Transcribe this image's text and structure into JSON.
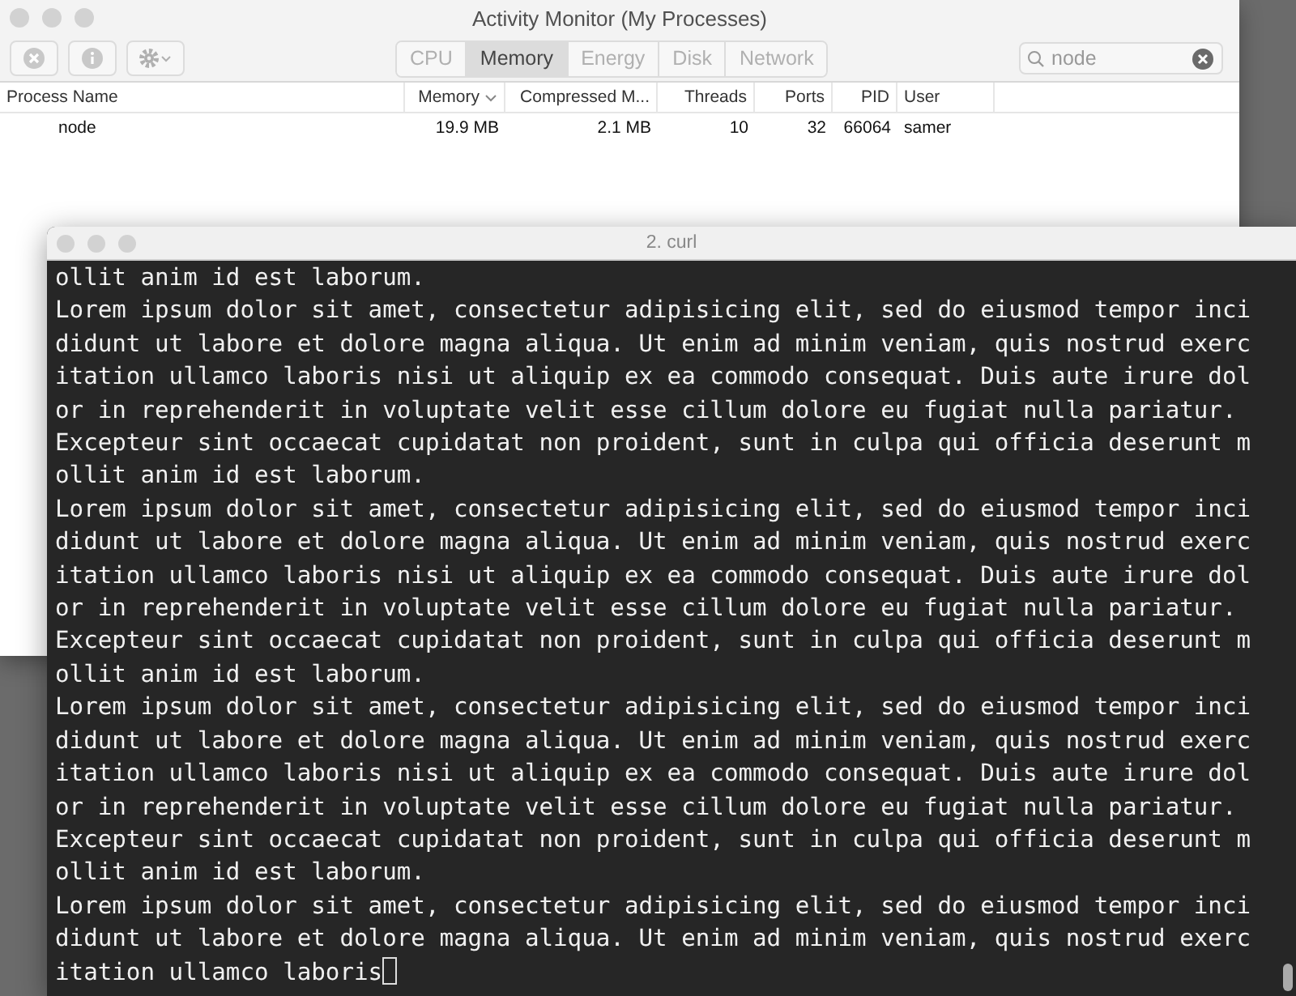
{
  "activity_monitor": {
    "window": {
      "title": "Activity Monitor (My Processes)"
    },
    "tabs": [
      {
        "label": "CPU",
        "selected": false
      },
      {
        "label": "Memory",
        "selected": true
      },
      {
        "label": "Energy",
        "selected": false
      },
      {
        "label": "Disk",
        "selected": false
      },
      {
        "label": "Network",
        "selected": false
      }
    ],
    "search": {
      "value": "node"
    },
    "table": {
      "columns": [
        {
          "label": "Process Name",
          "sorted": false
        },
        {
          "label": "Memory",
          "sorted": true
        },
        {
          "label": "Compressed M...",
          "sorted": false
        },
        {
          "label": "Threads",
          "sorted": false
        },
        {
          "label": "Ports",
          "sorted": false
        },
        {
          "label": "PID",
          "sorted": false
        },
        {
          "label": "User",
          "sorted": false
        }
      ],
      "rows": [
        [
          "node",
          "19.9 MB",
          "2.1 MB",
          "10",
          "32",
          "66064",
          "samer"
        ]
      ]
    }
  },
  "terminal": {
    "window": {
      "title": "2. curl"
    },
    "lines": [
      "ollit anim id est laborum.",
      "Lorem ipsum dolor sit amet, consectetur adipisicing elit, sed do eiusmod tempor inci",
      "didunt ut labore et dolore magna aliqua. Ut enim ad minim veniam, quis nostrud exerc",
      "itation ullamco laboris nisi ut aliquip ex ea commodo consequat. Duis aute irure dol",
      "or in reprehenderit in voluptate velit esse cillum dolore eu fugiat nulla pariatur.",
      "Excepteur sint occaecat cupidatat non proident, sunt in culpa qui officia deserunt m",
      "ollit anim id est laborum.",
      "Lorem ipsum dolor sit amet, consectetur adipisicing elit, sed do eiusmod tempor inci",
      "didunt ut labore et dolore magna aliqua. Ut enim ad minim veniam, quis nostrud exerc",
      "itation ullamco laboris nisi ut aliquip ex ea commodo consequat. Duis aute irure dol",
      "or in reprehenderit in voluptate velit esse cillum dolore eu fugiat nulla pariatur.",
      "Excepteur sint occaecat cupidatat non proident, sunt in culpa qui officia deserunt m",
      "ollit anim id est laborum.",
      "Lorem ipsum dolor sit amet, consectetur adipisicing elit, sed do eiusmod tempor inci",
      "didunt ut labore et dolore magna aliqua. Ut enim ad minim veniam, quis nostrud exerc",
      "itation ullamco laboris nisi ut aliquip ex ea commodo consequat. Duis aute irure dol",
      "or in reprehenderit in voluptate velit esse cillum dolore eu fugiat nulla pariatur.",
      "Excepteur sint occaecat cupidatat non proident, sunt in culpa qui officia deserunt m",
      "ollit anim id est laborum.",
      "Lorem ipsum dolor sit amet, consectetur adipisicing elit, sed do eiusmod tempor inci",
      "didunt ut labore et dolore magna aliqua. Ut enim ad minim veniam, quis nostrud exerc",
      "itation ullamco laboris"
    ]
  }
}
